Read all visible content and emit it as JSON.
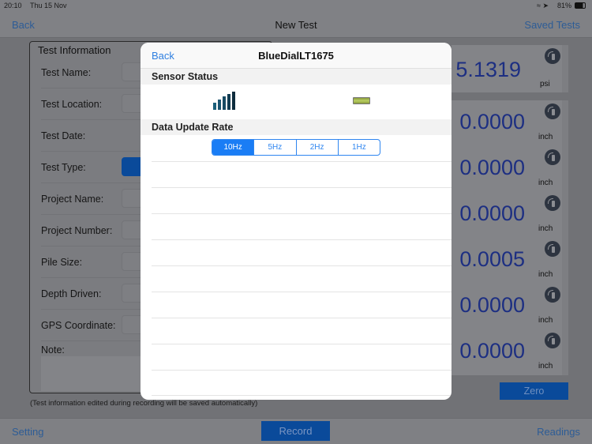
{
  "status": {
    "time": "20:10",
    "date": "Thu 15 Nov",
    "battery": "81%"
  },
  "nav": {
    "back": "Back",
    "title": "New Test",
    "saved": "Saved Tests"
  },
  "panel": {
    "title": "Test Information",
    "fields": [
      "Test Name:",
      "Test Location:",
      "Test Date:",
      "Test Type:",
      "Project Name:",
      "Project Number:",
      "Pile Size:",
      "Depth Driven:",
      "GPS Coordinate:"
    ],
    "note": "Note:",
    "footnote": "(Test information edited during recording will be saved automatically)"
  },
  "readouts": [
    {
      "value": "5.1319",
      "unit": "psi"
    },
    {
      "value": "0.0000",
      "unit": "inch"
    },
    {
      "value": "0.0000",
      "unit": "inch"
    },
    {
      "value": "0.0000",
      "unit": "inch"
    },
    {
      "value": "0.0005",
      "unit": "inch"
    },
    {
      "value": "0.0000",
      "unit": "inch"
    },
    {
      "value": "0.0000",
      "unit": "inch"
    }
  ],
  "zero": "Zero",
  "bottom": {
    "setting": "Setting",
    "record": "Record",
    "readings": "Readings"
  },
  "modal": {
    "back": "Back",
    "title": "BlueDialLT1675",
    "sensor_status": "Sensor Status",
    "rate_title": "Data Update Rate",
    "rates": [
      "10Hz",
      "5Hz",
      "2Hz",
      "1Hz"
    ],
    "selected_rate": "10Hz"
  }
}
